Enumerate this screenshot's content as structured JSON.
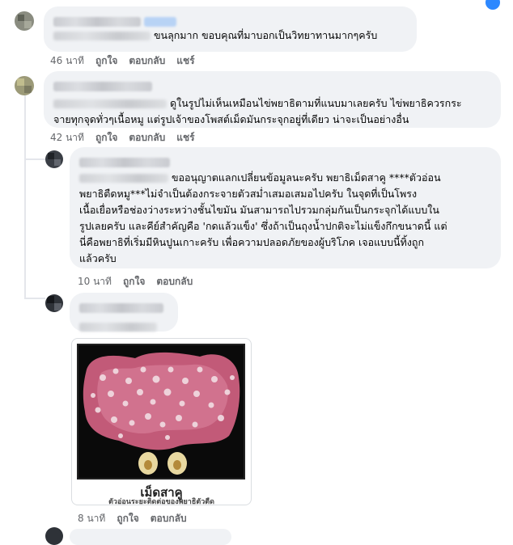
{
  "comments": [
    {
      "text": "ขนลุกมาก ขอบคุณที่มาบอกเป็นวิทยาทานมากๆครับ",
      "time": "46 นาที",
      "like": "ถูกใจ",
      "reply": "ตอบกลับ",
      "share": "แชร์"
    },
    {
      "text_line1": "ดูในรูปไม่เห็นเหมือนไข่พยาธิตามที่แนบมาเลยครับ ไข่พยาธิควรกระ",
      "text_line2": "จายทุกจุดทั่วๆเนื้อหมู แต่รูปเจ้าของโพสต์เม็ดมันกระจุกอยู่ที่เดียว น่าจะเป็นอย่างอื่น",
      "time": "42 นาที",
      "like": "ถูกใจ",
      "reply": "ตอบกลับ",
      "share": "แชร์"
    },
    {
      "lines": [
        "ขออนุญาตแลกเปลี่ยนข้อมูลนะครับ พยาธิเม็ดสาคู ****ตัวอ่อน",
        "พยาธิตืดหมู***ไม่จำเป็นต้องกระจายตัวสม่ำเสมอเสมอไปครับ ในจุดที่เป็นโพรง",
        "เนื้อเยื่อหรือช่องว่างระหว่างชั้นไขมัน มันสามารถไปรวมกลุ่มกันเป็นกระจุกได้แบบใน",
        "รูปเลยครับ และคีย์สำคัญคือ 'กดแล้วแข็ง' ซึ่งถ้าเป็นถุงน้ำปกติจะไม่แข็งกึกขนาดนี้ แต่",
        "นี่คือพยาธิที่เริ่มมีหินปูนเกาะครับ เพื่อความปลอดภัยของผู้บริโภค เจอแบบนี้ทิ้งถูก",
        "แล้วครับ"
      ],
      "time": "10 นาที",
      "like": "ถูกใจ",
      "reply": "ตอบกลับ"
    },
    {
      "image_caption_title": "เม็ดสาคู",
      "image_caption_sub": "ตัวอ่อนระยะติดต่อของพยาธิตัวตืด",
      "time": "8 นาที",
      "like": "ถูกใจ",
      "reply": "ตอบกลับ"
    }
  ],
  "colors": {
    "bubble": "#f0f2f5",
    "meta_text": "#65676b",
    "accent": "#2d88ff",
    "meat": "#c25a78"
  },
  "icons": [
    "user-avatar-icon",
    "notification-dot-icon"
  ]
}
